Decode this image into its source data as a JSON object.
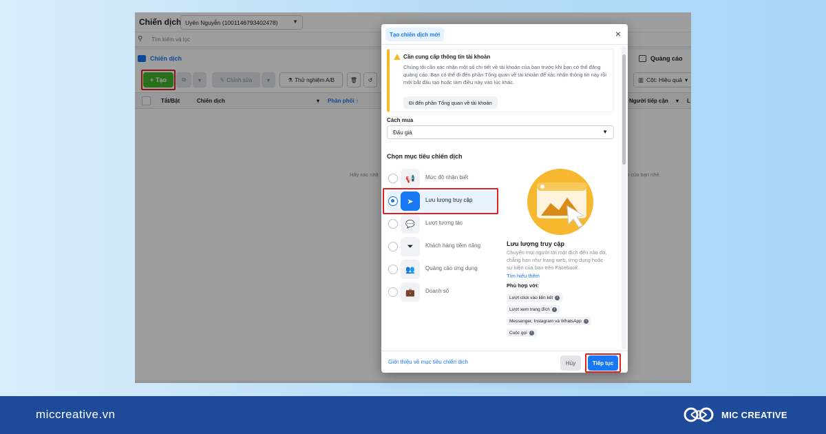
{
  "colors": {
    "accent": "#1877f2",
    "create_green": "#42b72a",
    "highlight_red": "#e02020",
    "warning_yellow": "#f7b928",
    "footer_blue": "#1e4a9a",
    "illustration_yellow": "#f5b82e"
  },
  "background_app": {
    "title": "Chiến dịch",
    "account": "Uyên Nguyễn (1001146793402478)",
    "search_placeholder": "Tìm kiếm và lọc",
    "tabs": {
      "campaigns": "Chiến dịch",
      "ads": "Quảng cáo"
    },
    "toolbar": {
      "create": "Tạo",
      "edit": "Chỉnh sửa",
      "ab_test": "Thử nghiệm A/B",
      "columns": "Cột: Hiệu quả"
    },
    "table_headers": {
      "toggle": "Tắt/Bật",
      "campaign": "Chiến dịch",
      "delivery": "Phân phối ↑",
      "reach": "Người tiếp cận",
      "last": "L"
    },
    "empty_left": "Hãy xác nhậ",
    "empty_right": "n của bạn nhé."
  },
  "modal": {
    "tab_label": "Tạo chiến dịch mới",
    "close_icon": "×",
    "warning": {
      "title": "Cần cung cấp thông tin tài khoản",
      "body": "Chúng tôi cần xác nhận một số chi tiết về tài khoản của bạn trước khi bạn có thể đăng quảng cáo. Bạn có thể đi đến phần Tổng quan về tài khoản để xác nhận thông tin này rồi mới bắt đầu tạo hoặc làm điều này vào lúc khác.",
      "button": "Đi đến phần Tổng quan về tài khoản"
    },
    "buying_type_label": "Cách mua",
    "buying_type_value": "Đấu giá",
    "objectives_title": "Chọn mục tiêu chiến dịch",
    "objectives": [
      {
        "label": "Mức độ nhận biết",
        "icon": "megaphone-icon",
        "glyph": "📢"
      },
      {
        "label": "Lưu lượng truy cập",
        "icon": "cursor-icon",
        "glyph": "➤"
      },
      {
        "label": "Lượt tương tác",
        "icon": "chat-bubbles-icon",
        "glyph": "💬"
      },
      {
        "label": "Khách hàng tiềm năng",
        "icon": "funnel-icon",
        "glyph": "⏷"
      },
      {
        "label": "Quảng cáo ứng dụng",
        "icon": "people-icon",
        "glyph": "👥"
      },
      {
        "label": "Doanh số",
        "icon": "briefcase-icon",
        "glyph": "💼"
      }
    ],
    "selected_objective_index": 1,
    "detail": {
      "title": "Lưu lượng truy cập",
      "description": "Chuyển mọi người tới một đích đến nào đó, chẳng hạn như trang web, ứng dụng hoặc sự kiện của bạn trên Facebook.",
      "learn_more": "Tìm hiểu thêm",
      "fit_label": "Phù hợp với:",
      "chips": [
        "Lượt click vào liên kết",
        "Lượt xem trang đích",
        "Messenger, Instagram và WhatsApp",
        "Cuộc gọi"
      ]
    },
    "footer": {
      "link": "Giới thiệu về mục tiêu chiến dịch",
      "cancel": "Hủy",
      "continue": "Tiếp tục"
    }
  },
  "bottom_bar": {
    "website": "miccreative.vn",
    "brand": "MIC CREATIVE"
  }
}
